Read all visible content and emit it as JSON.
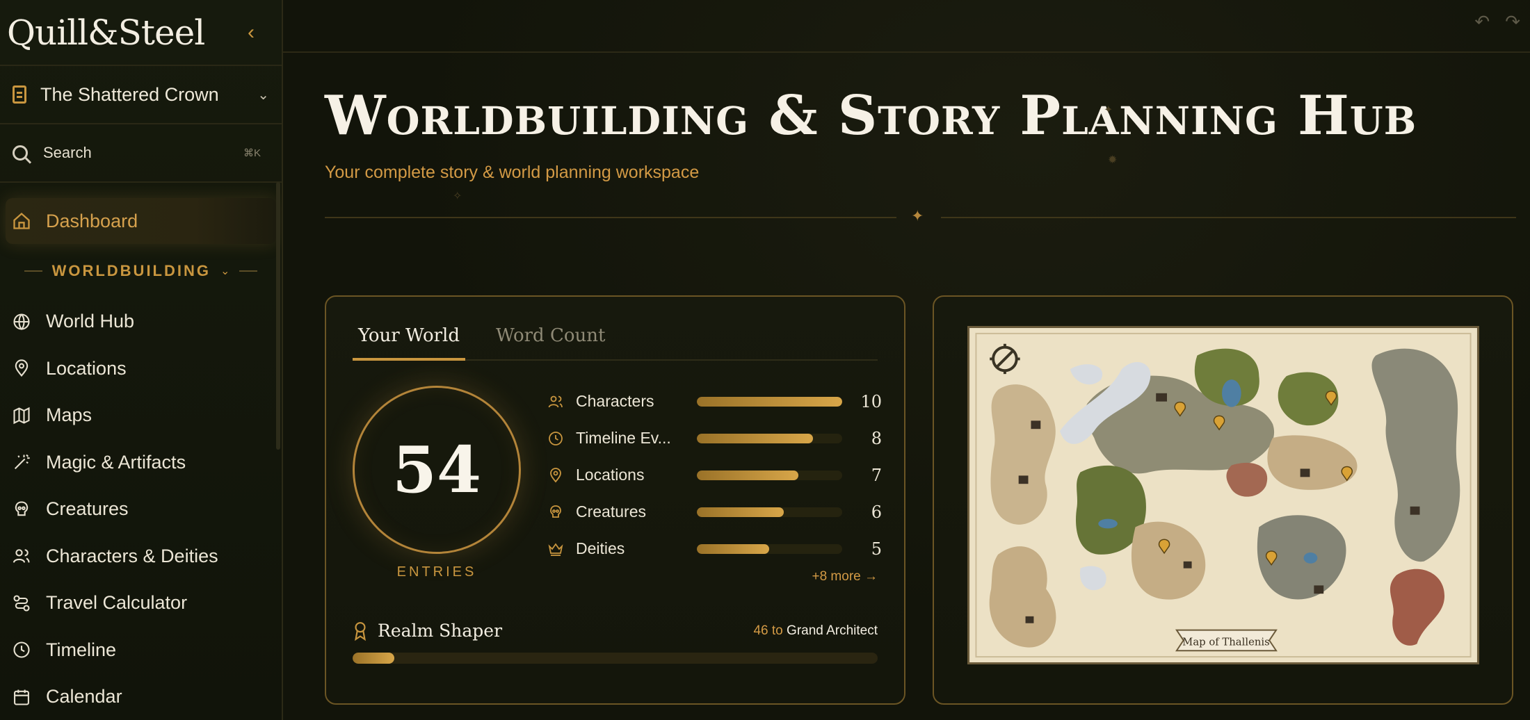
{
  "brand": {
    "name": "Quill&Steel"
  },
  "project": {
    "name": "The Shattered Crown"
  },
  "search": {
    "label": "Search",
    "shortcut": "⌘K"
  },
  "nav": {
    "dashboard": "Dashboard",
    "section": "WORLDBUILDING",
    "items": [
      {
        "label": "World Hub",
        "icon": "globe-icon"
      },
      {
        "label": "Locations",
        "icon": "map-pin-icon"
      },
      {
        "label": "Maps",
        "icon": "map-icon"
      },
      {
        "label": "Magic & Artifacts",
        "icon": "wand-icon"
      },
      {
        "label": "Creatures",
        "icon": "skull-icon"
      },
      {
        "label": "Characters & Deities",
        "icon": "users-icon"
      },
      {
        "label": "Travel Calculator",
        "icon": "route-icon"
      },
      {
        "label": "Timeline",
        "icon": "clock-icon"
      },
      {
        "label": "Calendar",
        "icon": "calendar-icon"
      }
    ]
  },
  "header": {
    "title": "Worldbuilding & Story Planning Hub",
    "subtitle": "Your complete story & world planning workspace"
  },
  "world_panel": {
    "tabs": [
      "Your World",
      "Word Count"
    ],
    "active_tab": "Your World",
    "total": "54",
    "total_label": "ENTRIES",
    "stats": [
      {
        "name": "Characters",
        "count": "10",
        "fill": 1.0,
        "icon": "users-icon"
      },
      {
        "name": "Timeline Ev...",
        "count": "8",
        "fill": 0.8,
        "icon": "clock-icon"
      },
      {
        "name": "Locations",
        "count": "7",
        "fill": 0.7,
        "icon": "map-pin-icon"
      },
      {
        "name": "Creatures",
        "count": "6",
        "fill": 0.6,
        "icon": "skull-icon"
      },
      {
        "name": "Deities",
        "count": "5",
        "fill": 0.5,
        "icon": "crown-icon"
      }
    ],
    "more": "+8 more →",
    "rank": {
      "title": "Realm Shaper",
      "remaining": "46",
      "to_word": "to",
      "next": "Grand Architect",
      "progress": 0.08
    }
  },
  "map_panel": {
    "caption": "Map of Thallenis"
  },
  "colors": {
    "accent": "#c9963f",
    "background": "#12140a"
  }
}
